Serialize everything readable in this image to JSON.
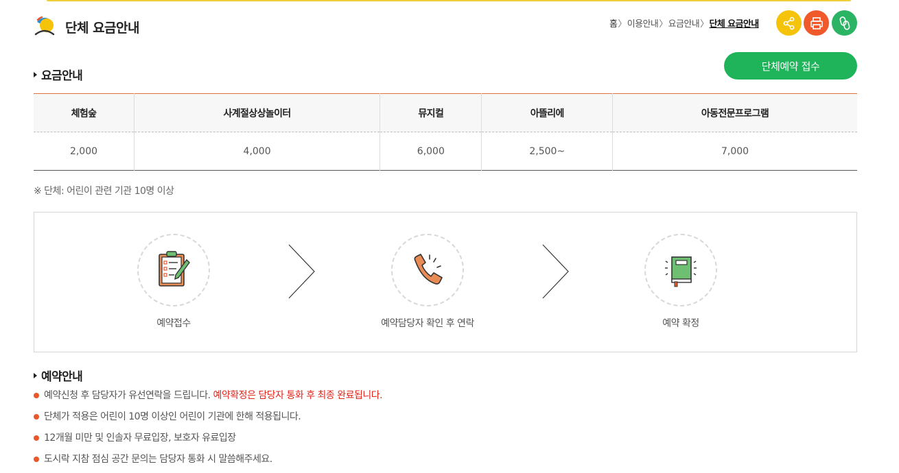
{
  "header": {
    "title": "단체 요금안내",
    "breadcrumb": [
      "홈",
      "이용안내",
      "요금안내",
      "단체 요금안내"
    ],
    "share_icon": "share-icon",
    "print_icon": "printer-icon",
    "link_icon": "link-icon"
  },
  "fee_section": {
    "title": "요금안내",
    "reserve_button": "단체예약 접수",
    "columns": [
      "체험숲",
      "사계절상상놀이터",
      "뮤지컬",
      "아뜰리에",
      "아동전문프로그램"
    ],
    "prices": [
      "2,000",
      "4,000",
      "6,000",
      "2,500~",
      "7,000"
    ],
    "note": "※ 단체: 어린이 관련 기관 10명 이상"
  },
  "process": {
    "steps": [
      {
        "label": "예약접수",
        "icon": "clipboard-icon"
      },
      {
        "label": "예약담당자 확인 후 연락",
        "icon": "phone-icon"
      },
      {
        "label": "예약 확정",
        "icon": "book-icon"
      }
    ]
  },
  "guide": {
    "title": "예약안내",
    "items": [
      {
        "text": "예약신청 후 담당자가 유선연락을 드립니다. ",
        "highlight": "예약확정은 담당자 통화 후 최종 완료됩니다."
      },
      {
        "text": "단체가 적용은 어린이 10명 이상인 어린이 기관에 한해 적용됩니다.",
        "highlight": ""
      },
      {
        "text": "12개월 미만 및 인솔자 무료입장, 보호자 유료입장",
        "highlight": ""
      },
      {
        "text": "도시락 지참 점심 공간 문의는 담당자 통화 시 말씀해주세요.",
        "highlight": ""
      }
    ]
  },
  "colors": {
    "accent_green": "#1fb35a",
    "accent_orange": "#e8582a",
    "highlight_red": "#e0251b",
    "share_yellow": "#f5c30a",
    "print_red": "#f05a2b",
    "link_green": "#2ab463"
  }
}
